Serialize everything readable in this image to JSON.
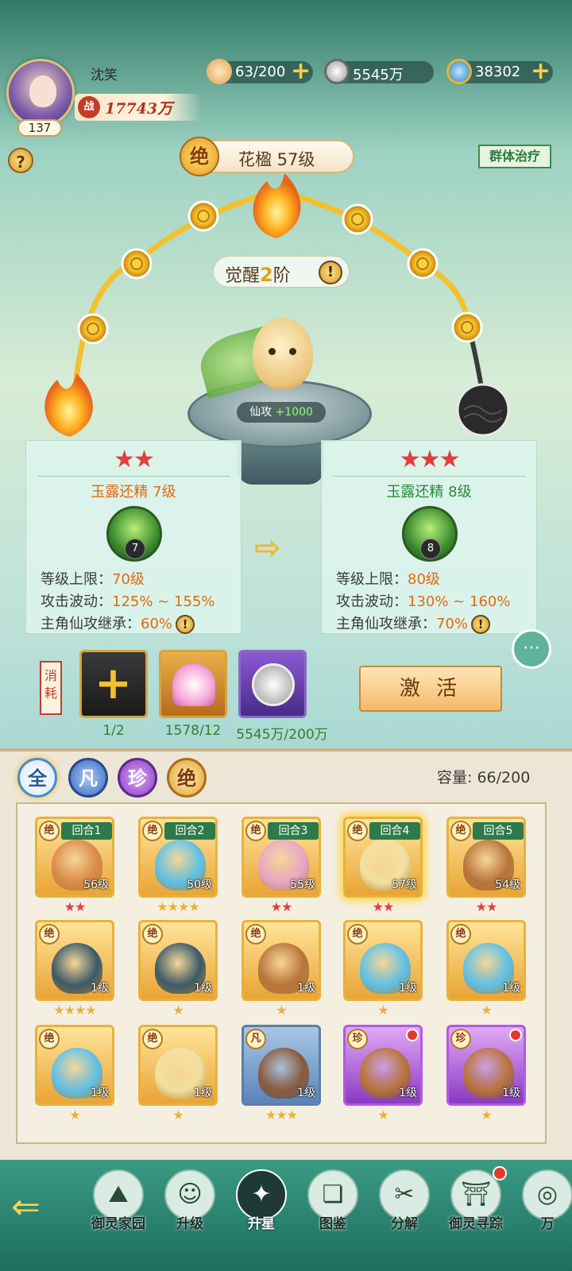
{
  "player": {
    "name": "沈笑",
    "level": "137",
    "power_icon": "战",
    "power": "17743万"
  },
  "resources": [
    {
      "icon": "bun-icon",
      "value": "63/200",
      "has_plus": true,
      "color": "#f0c27a"
    },
    {
      "icon": "coin-icon",
      "value": "5545万",
      "has_plus": false,
      "color": "#c8c8c8"
    },
    {
      "icon": "swirl-gem-icon",
      "value": "38302",
      "has_plus": true,
      "color": "#4aa6e0"
    }
  ],
  "help_label": "?",
  "pet_title": {
    "badge": "绝",
    "text": "花楹 57级"
  },
  "skill_tag": "群体治疗",
  "awaken": {
    "prefix": "觉醒",
    "num": "2",
    "suffix": "阶",
    "icon_label": "!"
  },
  "pet_stat": {
    "label": "仙攻",
    "value": "+1000"
  },
  "compare": {
    "current": {
      "stars": "★★",
      "name": "玉露还精 7级",
      "icon_level": "7",
      "name_color": "#e06a10",
      "rows": [
        {
          "label": "等级上限：",
          "value": "70级"
        },
        {
          "label": "攻击波动：",
          "value": "125% ~ 155%"
        },
        {
          "label": "主角仙攻继承：",
          "value": "60%"
        }
      ]
    },
    "next": {
      "stars": "★★★",
      "name": "玉露还精 8级",
      "icon_level": "8",
      "name_color": "#2a8a3a",
      "rows": [
        {
          "label": "等级上限：",
          "value": "80级"
        },
        {
          "label": "攻击波动：",
          "value": "130% ~ 160%"
        },
        {
          "label": "主角仙攻继承：",
          "value": "70%"
        }
      ]
    },
    "arrow": "⇨"
  },
  "chat_icon": "chat-bubble-icon",
  "consume": {
    "label": "消耗",
    "items": [
      {
        "name": "add-pet-slot",
        "count": "1/2"
      },
      {
        "name": "lotus-item",
        "count": "1578/12"
      },
      {
        "name": "coin-item",
        "count": "5545万/200万"
      }
    ],
    "button": "激 活"
  },
  "filters": [
    {
      "label": "全",
      "color": "#4a8ad0",
      "active": true
    },
    {
      "label": "凡",
      "color": "#4a7ad0",
      "active": false
    },
    {
      "label": "珍",
      "color": "#9a4ad0",
      "active": false
    },
    {
      "label": "绝",
      "color": "#e0a030",
      "active": false
    }
  ],
  "capacity": "容量:  66/200",
  "pets": [
    {
      "grade": "绝",
      "round": "回合1",
      "level": "56级",
      "stars": "★★",
      "star_color": "red",
      "kind": "jue",
      "creature": "#d98a4a"
    },
    {
      "grade": "绝",
      "round": "回合2",
      "level": "50级",
      "stars": "★★★★",
      "star_color": "gold",
      "kind": "jue",
      "creature": "#5ec0e6"
    },
    {
      "grade": "绝",
      "round": "回合3",
      "level": "55级",
      "stars": "★★",
      "star_color": "red",
      "kind": "jue",
      "creature": "#e8a6c6"
    },
    {
      "grade": "绝",
      "round": "回合4",
      "level": "57级",
      "stars": "★★",
      "star_color": "red",
      "kind": "jue",
      "creature": "#f2e0a0",
      "selected": true
    },
    {
      "grade": "绝",
      "round": "回合5",
      "level": "54级",
      "stars": "★★",
      "star_color": "red",
      "kind": "jue",
      "creature": "#b8743a"
    },
    {
      "grade": "绝",
      "round": "",
      "level": "1级",
      "stars": "★★★★",
      "star_color": "gold",
      "kind": "jue",
      "creature": "#3a5a6a"
    },
    {
      "grade": "绝",
      "round": "",
      "level": "1级",
      "stars": "★",
      "star_color": "gold",
      "kind": "jue",
      "creature": "#3a5a6a"
    },
    {
      "grade": "绝",
      "round": "",
      "level": "1级",
      "stars": "★",
      "star_color": "gold",
      "kind": "jue",
      "creature": "#b8743a"
    },
    {
      "grade": "绝",
      "round": "",
      "level": "1级",
      "stars": "★",
      "star_color": "gold",
      "kind": "jue",
      "creature": "#5ec0e6"
    },
    {
      "grade": "绝",
      "round": "",
      "level": "1级",
      "stars": "★",
      "star_color": "gold",
      "kind": "jue",
      "creature": "#5ec0e6"
    },
    {
      "grade": "绝",
      "round": "",
      "level": "1级",
      "stars": "★",
      "star_color": "gold",
      "kind": "jue",
      "creature": "#5ec0e6"
    },
    {
      "grade": "绝",
      "round": "",
      "level": "1级",
      "stars": "★",
      "star_color": "gold",
      "kind": "jue",
      "creature": "#f2e0a0"
    },
    {
      "grade": "凡",
      "round": "",
      "level": "1级",
      "stars": "★★★",
      "star_color": "gold",
      "kind": "fan",
      "creature": "#8a5a3a"
    },
    {
      "grade": "珍",
      "round": "",
      "level": "1级",
      "stars": "★",
      "star_color": "gold",
      "kind": "zhen",
      "creature": "#b8743a",
      "dot": true
    },
    {
      "grade": "珍",
      "round": "",
      "level": "1级",
      "stars": "★",
      "star_color": "gold",
      "kind": "zhen",
      "creature": "#b8743a",
      "dot": true
    }
  ],
  "nav": [
    {
      "label": "御灵家园",
      "icon": "mountain-icon",
      "glyph": "⛰",
      "active": false,
      "dot": false
    },
    {
      "label": "升级",
      "icon": "pet-face-icon",
      "glyph": "☺",
      "active": false,
      "dot": false
    },
    {
      "label": "升星",
      "icon": "stars-icon",
      "glyph": "✦",
      "active": true,
      "dot": false
    },
    {
      "label": "图鉴",
      "icon": "cards-icon",
      "glyph": "❏",
      "active": false,
      "dot": false
    },
    {
      "label": "分解",
      "icon": "split-icon",
      "glyph": "✂",
      "active": false,
      "dot": false
    },
    {
      "label": "御灵寻踪",
      "icon": "gate-icon",
      "glyph": "⛩",
      "active": false,
      "dot": true
    },
    {
      "label": "万",
      "icon": "more-icon",
      "glyph": "◎",
      "active": false,
      "dot": false
    }
  ],
  "back_icon": "back-arrow-icon"
}
